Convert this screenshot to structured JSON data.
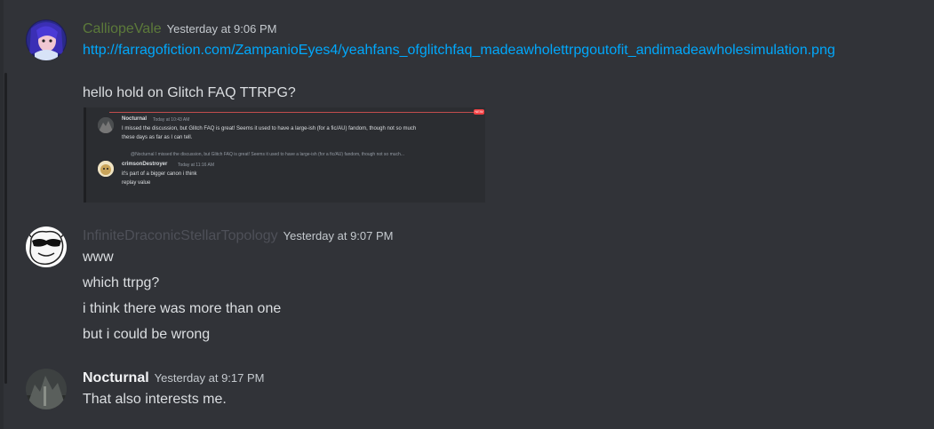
{
  "messages": [
    {
      "author": "CalliopeVale",
      "author_color": "#5c7a3a",
      "time": "Yesterday at 9:06 PM",
      "link": "http://farragofiction.com/ZampanioEyes4/yeahfans_ofglitchfaq_madeawholettrpgoutofit_andimadeawholesimulation.png",
      "text": "hello hold on Glitch FAQ TTRPG?",
      "embed": {
        "msg1_author": "Nocturnal",
        "msg1_time": "Today at 10:43 AM",
        "msg1_line1": "I missed the discussion, but Glitch FAQ is great! Seems it used to have a large-ish (for a fic/AU) fandom, though not so much",
        "msg1_line2": "these days as far as I can tell.",
        "reply_preview": "@Nocturnal I missed the discussion, but Glitch FAQ is great! Seems it used to have a large-ish (for a fic/AU) fandom, though not so much...",
        "msg2_author": "crimsonDestroyer",
        "msg2_time": "Today at 11:16 AM",
        "msg2_line1": "it's part of a bigger canon i think",
        "msg2_line2": "replay value",
        "new_label": "NEW"
      }
    },
    {
      "author": "InfiniteDraconicStellarTopology",
      "author_color": "#4e5058",
      "time": "Yesterday at 9:07 PM",
      "lines": [
        "www",
        "which ttrpg?",
        "i think there was more than one",
        "but i could be wrong"
      ]
    },
    {
      "author": "Nocturnal",
      "author_color": "#f2f3f5",
      "time": "Yesterday at 9:17 PM",
      "lines": [
        "That also interests me."
      ]
    }
  ]
}
